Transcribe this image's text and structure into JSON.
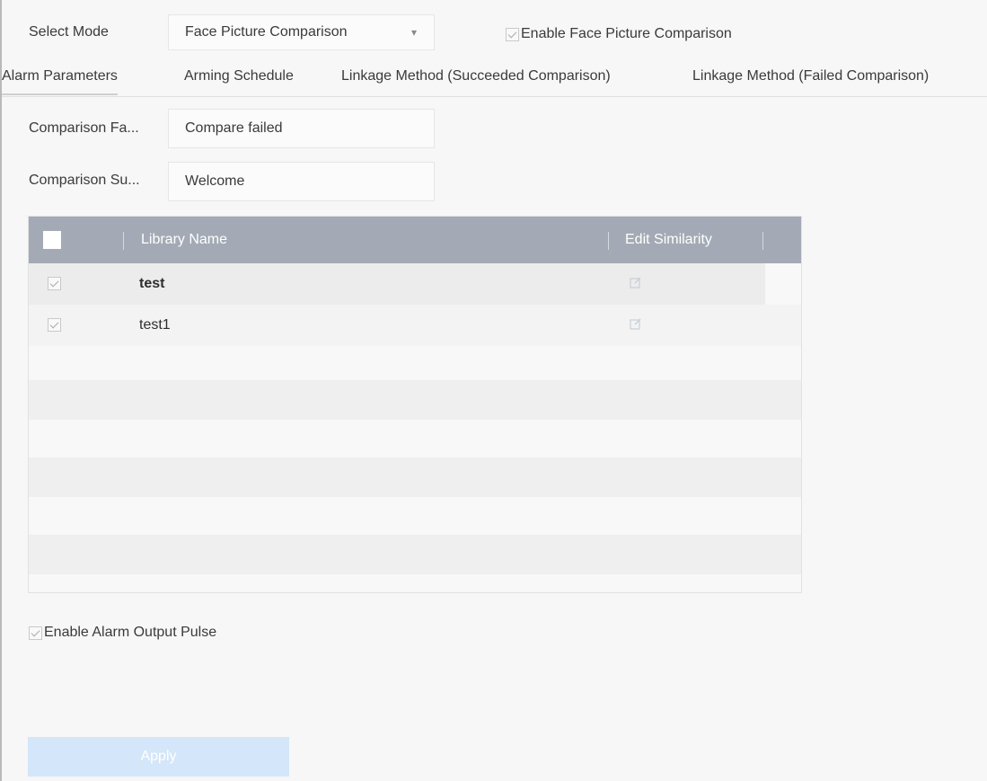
{
  "mode": {
    "label": "Select Mode",
    "value": "Face Picture Comparison",
    "enable_label": "Enable Face Picture Comparison"
  },
  "tabs": [
    {
      "label": "Alarm Parameters"
    },
    {
      "label": "Arming Schedule"
    },
    {
      "label": "Linkage Method (Succeeded Comparison)"
    },
    {
      "label": "Linkage Method (Failed Comparison)"
    }
  ],
  "fields": {
    "failed_label": "Comparison Fa...",
    "failed_value": "Compare failed",
    "success_label": "Comparison Su...",
    "success_value": "Welcome"
  },
  "table": {
    "col_name": "Library Name",
    "col_similarity": "Edit Similarity",
    "rows": [
      {
        "name": "test",
        "checked": true
      },
      {
        "name": "test1",
        "checked": true
      }
    ]
  },
  "pulse": {
    "label": "Enable Alarm Output Pulse",
    "checked": true
  },
  "apply_label": "Apply",
  "icons": {
    "edit": "edit-icon",
    "dropdown": "chevron-down-icon"
  },
  "colors": {
    "header": "#a3aab5",
    "apply": "#d4e6f9"
  }
}
